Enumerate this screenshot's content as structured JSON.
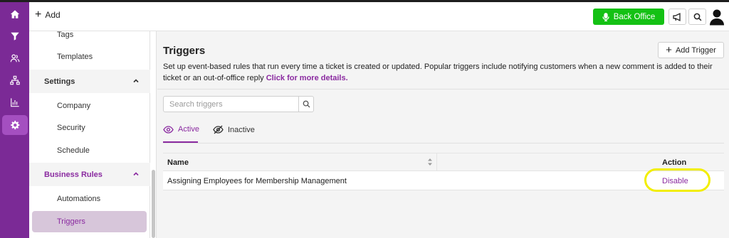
{
  "rail": {
    "items": [
      {
        "icon": "home-icon"
      },
      {
        "icon": "funnel-icon"
      },
      {
        "icon": "users-icon"
      },
      {
        "icon": "org-chart-icon"
      },
      {
        "icon": "bar-chart-icon"
      },
      {
        "icon": "gear-icon",
        "active": true
      }
    ],
    "bg_color": "#7b2a96",
    "active_color": "#a44fc0"
  },
  "topbar": {
    "add_label": "Add",
    "back_office_label": "Back Office",
    "back_office_color": "#14c114"
  },
  "subnav": {
    "items_top": [
      "Tags",
      "Templates"
    ],
    "settings": {
      "label": "Settings",
      "items": [
        "Company",
        "Security",
        "Schedule"
      ]
    },
    "business_rules": {
      "label": "Business Rules",
      "items": [
        "Automations",
        "Triggers"
      ],
      "selected": "Triggers"
    }
  },
  "main": {
    "title": "Triggers",
    "add_trigger_label": "Add Trigger",
    "description": "Set up event-based rules that run every time a ticket is created or updated. Popular triggers include notifying customers when a new comment is added to their ticket or an out-of-office reply",
    "description_link": "Click for more details.",
    "search_placeholder": "Search triggers",
    "tabs": [
      {
        "label": "Active",
        "icon": "eye-icon",
        "active": true
      },
      {
        "label": "Inactive",
        "icon": "eye-off-icon",
        "active": false
      }
    ],
    "table": {
      "columns": [
        "Name",
        "Action"
      ],
      "rows": [
        {
          "name": "Assigning Employees for Membership Management",
          "action": "Disable"
        }
      ]
    },
    "accent_color": "#8a2aa0"
  }
}
